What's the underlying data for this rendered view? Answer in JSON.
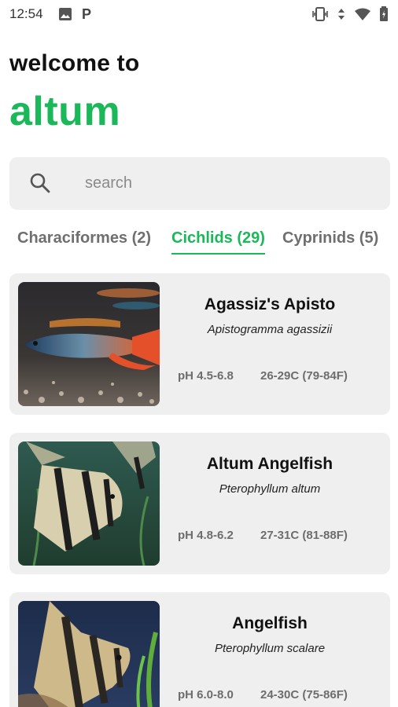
{
  "status_bar": {
    "time": "12:54",
    "left_icons": [
      "image-icon",
      "p-notification-icon"
    ],
    "right_icons": [
      "vibrate-icon",
      "data-arrows-icon",
      "wifi-icon",
      "battery-icon"
    ],
    "p_glyph": "P"
  },
  "header": {
    "welcome": "welcome to",
    "app_name": "altum",
    "accent_color": "#1bb85a"
  },
  "search": {
    "placeholder": "search"
  },
  "tabs": [
    {
      "label": "Characiformes (2)",
      "active": false
    },
    {
      "label": "Cichlids (29)",
      "active": true
    },
    {
      "label": "Cyprinids (5)",
      "active": false
    }
  ],
  "species": [
    {
      "name": "Agassiz's Apisto",
      "scientific": "Apistogramma agassizii",
      "ph": "pH 4.5-6.8",
      "temp": "26-29C (79-84F)"
    },
    {
      "name": "Altum Angelfish",
      "scientific": "Pterophyllum altum",
      "ph": "pH 4.8-6.2",
      "temp": "27-31C (81-88F)"
    },
    {
      "name": "Angelfish",
      "scientific": "Pterophyllum scalare",
      "ph": "pH 6.0-8.0",
      "temp": "24-30C (75-86F)"
    }
  ]
}
